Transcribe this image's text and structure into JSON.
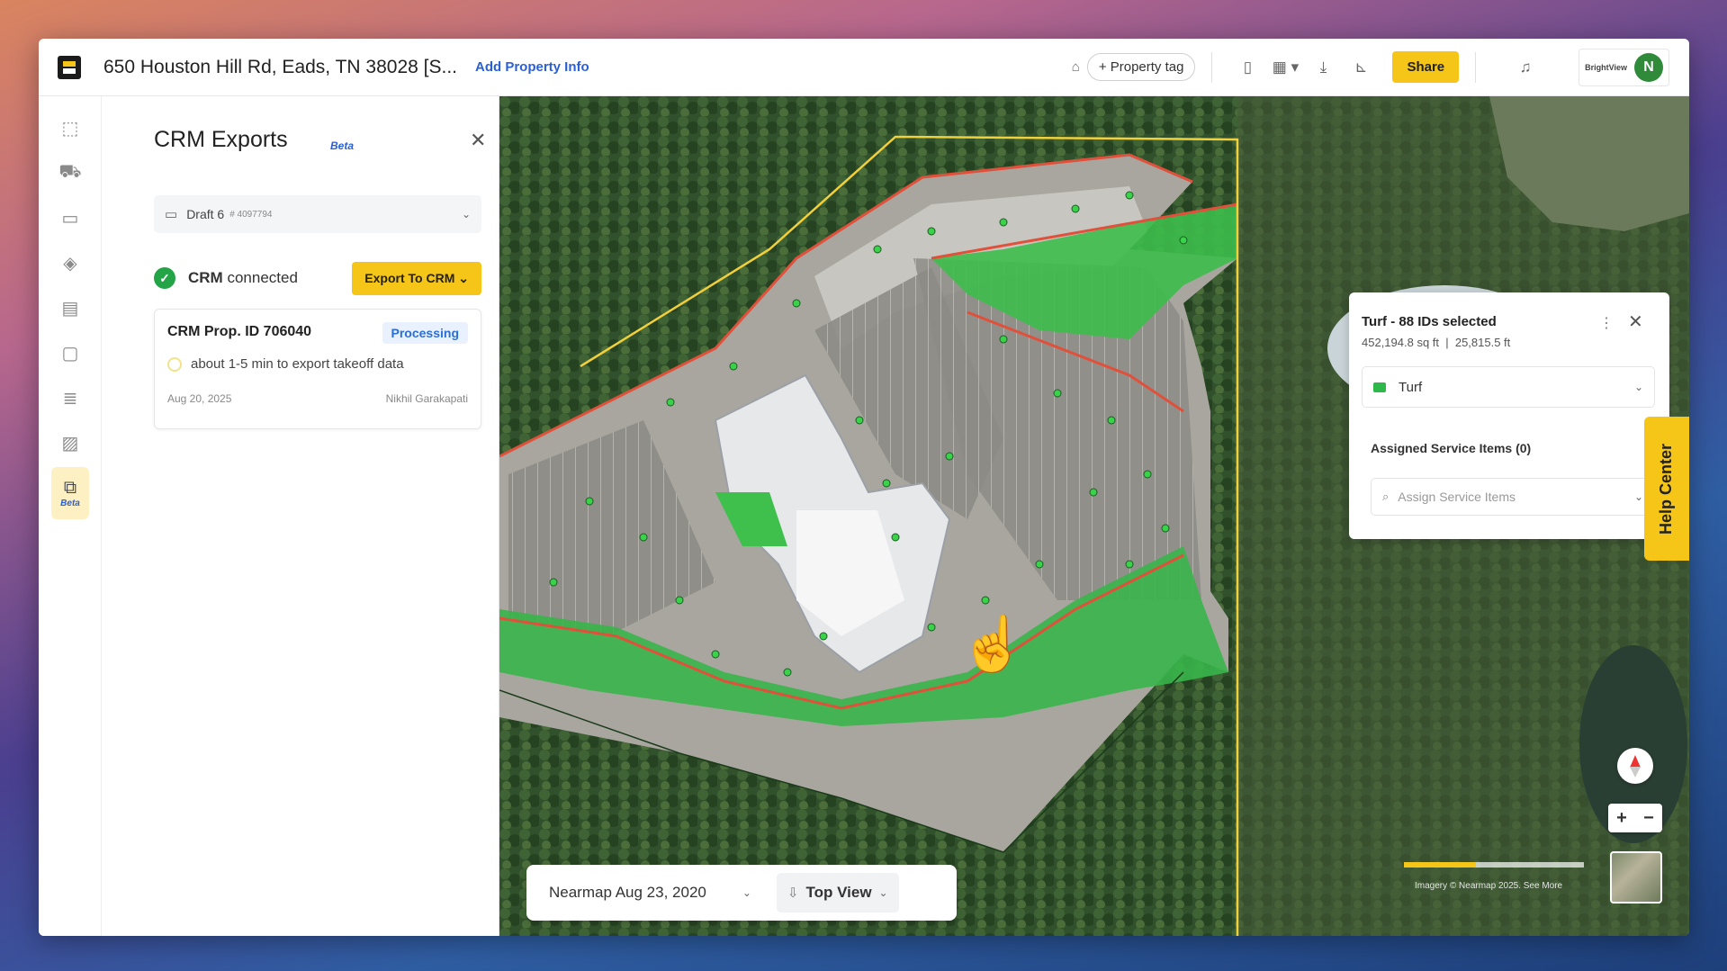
{
  "header": {
    "address": "650 Houston Hill Rd, Eads, TN 38028 [S...",
    "add_property_info": "Add Property Info",
    "property_tag": "+ Property tag",
    "share": "Share",
    "avatar_initial": "N",
    "user_logo_text": "BrightView"
  },
  "rail": {
    "items": [
      "takeoff-icon",
      "cart-icon",
      "folder-icon",
      "layers-icon",
      "estimate-icon",
      "chat-icon",
      "notes-icon",
      "image-icon",
      "crm-export-icon"
    ],
    "active_label": "Beta"
  },
  "panel": {
    "title": "CRM Exports",
    "beta": "Beta",
    "draft": {
      "label": "Draft 6",
      "sub": "# 4097794"
    },
    "crm_status_bold": "CRM",
    "crm_status_rest": "connected",
    "export_button": "Export To CRM",
    "card": {
      "title": "CRM Prop. ID 706040",
      "status": "Processing",
      "message": "about 1-5 min to export takeoff data",
      "date": "Aug 20, 2025",
      "user": "Nikhil Garakapati"
    }
  },
  "turf_card": {
    "title": "Turf - 88 IDs selected",
    "area": "452,194.8 sq ft",
    "perimeter": "25,815.5 ft",
    "selected_layer": "Turf",
    "assigned_label": "Assigned Service Items (0)",
    "assign_placeholder": "Assign Service Items"
  },
  "help_center": "Help Center",
  "bottom_bar": {
    "imagery": "Nearmap Aug 23, 2020",
    "view": "Top View"
  },
  "map_controls": {
    "zoom_in": "+",
    "zoom_out": "−",
    "scale_label": "Imagery © Nearmap 2025. See More"
  },
  "colors": {
    "accent": "#f5c518",
    "turf": "#2fb84a",
    "boundary": "#e0503a",
    "parcel": "#f2d03b"
  }
}
